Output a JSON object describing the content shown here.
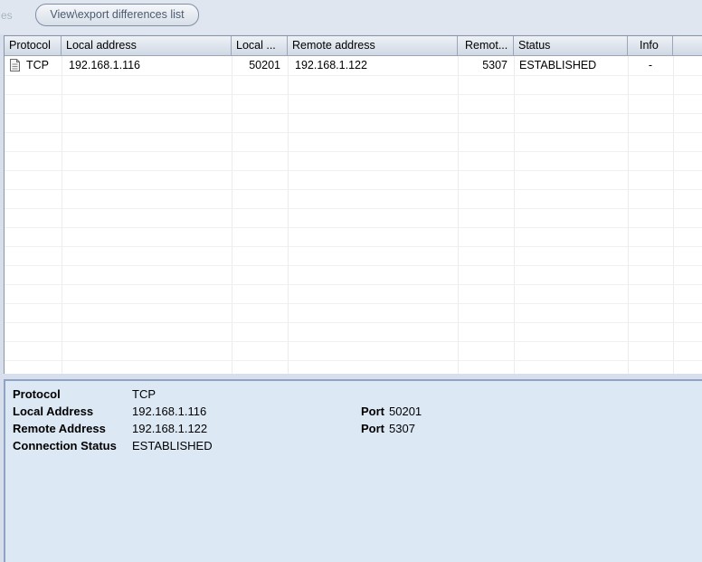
{
  "toolbar": {
    "faded_label": "es",
    "export_button": "View\\export differences list"
  },
  "table": {
    "columns": [
      "Protocol",
      "Local address",
      "Local ...",
      "Remote address",
      "Remot...",
      "Status",
      "Info"
    ],
    "rows": [
      {
        "icon": "document-icon",
        "protocol": "TCP",
        "local_address": "192.168.1.116",
        "local_port": "50201",
        "remote_address": "192.168.1.122",
        "remote_port": "5307",
        "status": "ESTABLISHED",
        "info": "-"
      }
    ]
  },
  "details": {
    "protocol_label": "Protocol",
    "protocol_value": "TCP",
    "local_label": "Local Address",
    "local_value": "192.168.1.116",
    "local_port_label": "Port",
    "local_port_value": "50201",
    "remote_label": "Remote Address",
    "remote_value": "192.168.1.122",
    "remote_port_label": "Port",
    "remote_port_value": "5307",
    "status_label": "Connection Status",
    "status_value": "ESTABLISHED"
  }
}
